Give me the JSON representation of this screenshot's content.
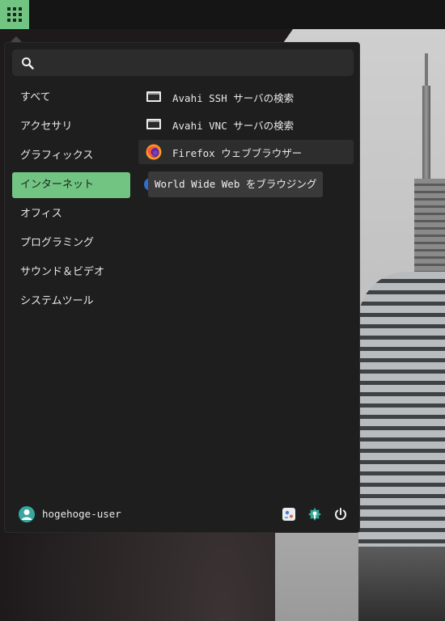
{
  "menu": {
    "search_placeholder": "",
    "categories": [
      {
        "label": "すべて"
      },
      {
        "label": "アクセサリ"
      },
      {
        "label": "グラフィックス"
      },
      {
        "label": "インターネット"
      },
      {
        "label": "オフィス"
      },
      {
        "label": "プログラミング"
      },
      {
        "label": "サウンド＆ビデオ"
      },
      {
        "label": "システムツール"
      }
    ],
    "active_category": "インターネット",
    "apps": [
      {
        "label": "Avahi SSH サーバの検索",
        "icon": "network-monitor-icon"
      },
      {
        "label": "Avahi VNC サーバの検索",
        "icon": "network-monitor-icon"
      },
      {
        "label": "Firefox ウェブブラウザー",
        "icon": "firefox-icon"
      }
    ],
    "tooltip": "World Wide Web をブラウジング",
    "user": {
      "name": "hogehoge-user"
    },
    "footer_buttons": [
      "settings-icon",
      "lock-screen-icon",
      "power-icon"
    ]
  },
  "colors": {
    "accent": "#72c482",
    "menu_bg": "#1e1e1e",
    "panel_bg": "#151515"
  }
}
